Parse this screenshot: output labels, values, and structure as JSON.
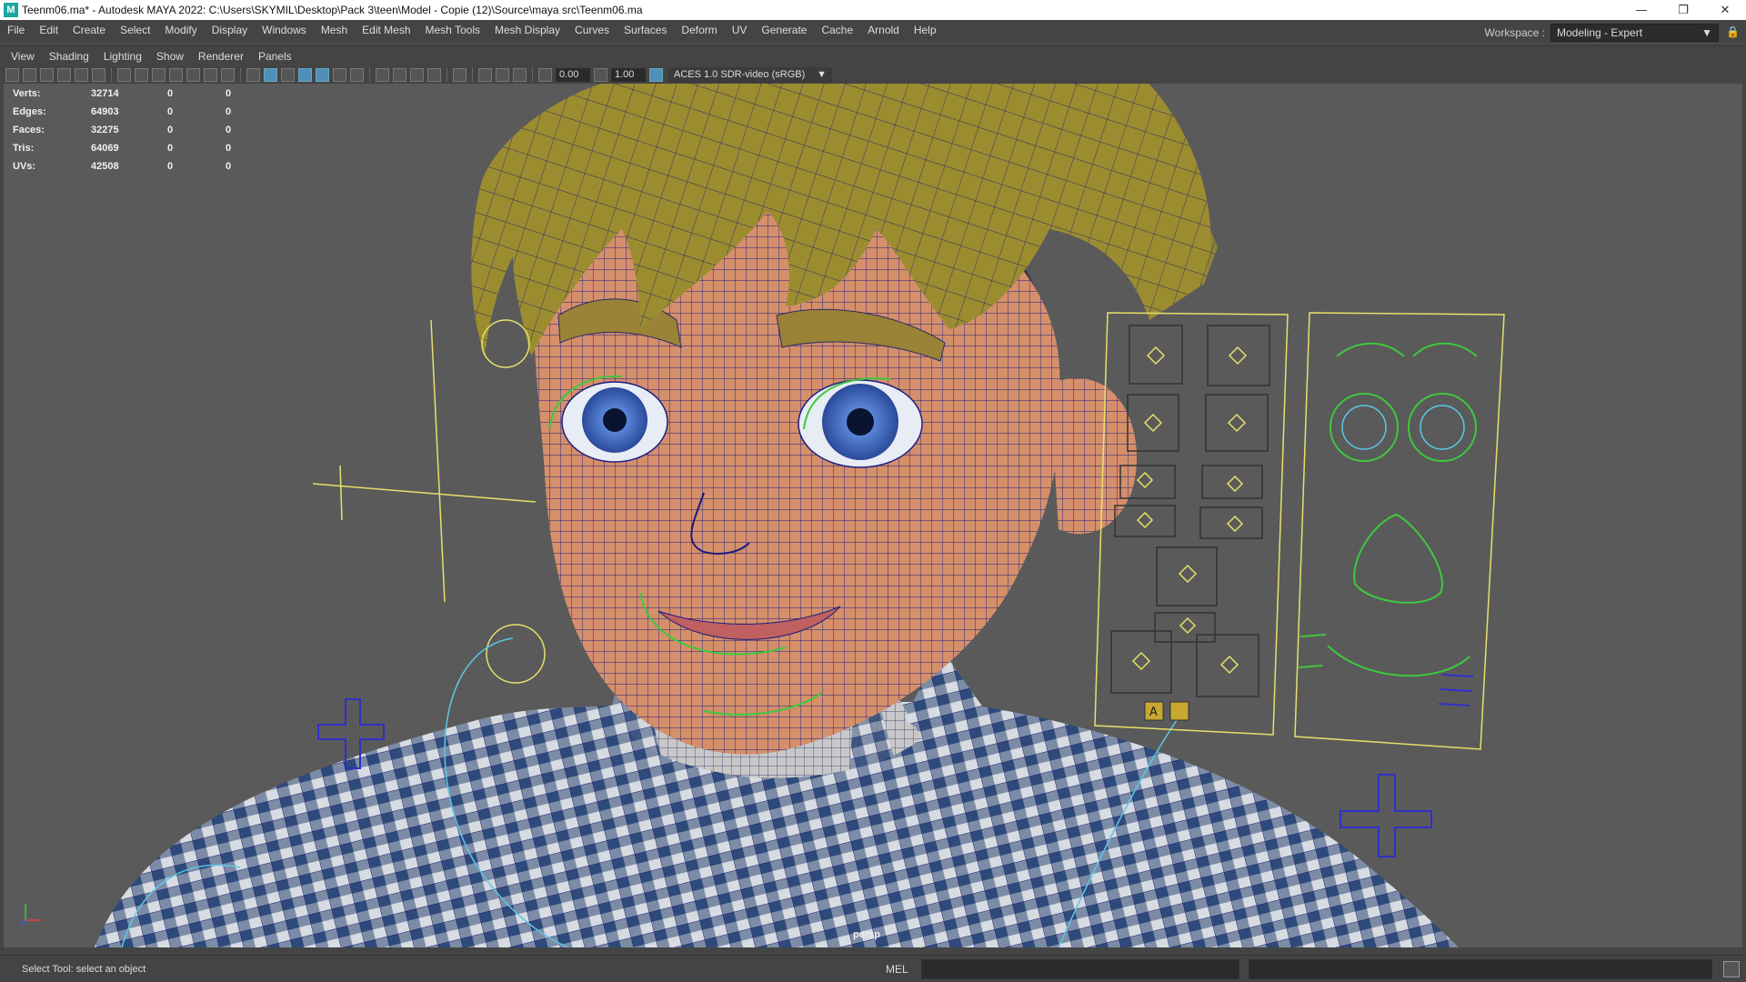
{
  "titlebar": {
    "logo": "M",
    "title": "Teenm06.ma* - Autodesk MAYA 2022: C:\\Users\\SKYMIL\\Desktop\\Pack 3\\teen\\Model - Copie (12)\\Source\\maya src\\Teenm06.ma",
    "minimize": "—",
    "restore": "❐",
    "close": "✕"
  },
  "menubar": {
    "items": [
      "File",
      "Edit",
      "Create",
      "Select",
      "Modify",
      "Display",
      "Windows",
      "Mesh",
      "Edit Mesh",
      "Mesh Tools",
      "Mesh Display",
      "Curves",
      "Surfaces",
      "Deform",
      "UV",
      "Generate",
      "Cache",
      "Arnold",
      "Help"
    ]
  },
  "workspace": {
    "label": "Workspace :",
    "value": "Modeling - Expert",
    "arrow": "▼"
  },
  "panel_menu": {
    "items": [
      "View",
      "Shading",
      "Lighting",
      "Show",
      "Renderer",
      "Panels"
    ]
  },
  "panel_toolbar": {
    "exposure": "0.00",
    "gamma": "1.00",
    "color_space": "ACES 1.0 SDR-video (sRGB)",
    "color_space_arrow": "▼"
  },
  "hud": {
    "rows": [
      {
        "label": "Verts:",
        "v1": "32714",
        "v2": "0",
        "v3": "0"
      },
      {
        "label": "Edges:",
        "v1": "64903",
        "v2": "0",
        "v3": "0"
      },
      {
        "label": "Faces:",
        "v1": "32275",
        "v2": "0",
        "v3": "0"
      },
      {
        "label": "Tris:",
        "v1": "64069",
        "v2": "0",
        "v3": "0"
      },
      {
        "label": "UVs:",
        "v1": "42508",
        "v2": "0",
        "v3": "0"
      }
    ]
  },
  "viewport": {
    "camera": "persp",
    "face_panel_text": "A"
  },
  "helpline": {
    "text": "Select Tool: select an object",
    "mel_label": "MEL"
  },
  "colors": {
    "viewport_bg": "#5a5a5a",
    "skin": "#d7916a",
    "hair": "#9a8a2e",
    "wire": "#1c1c8a",
    "rig_yellow": "#e6e06a",
    "rig_green": "#3ec83e",
    "rig_blue": "#3030c8",
    "rig_cyan": "#5ac8e6"
  }
}
